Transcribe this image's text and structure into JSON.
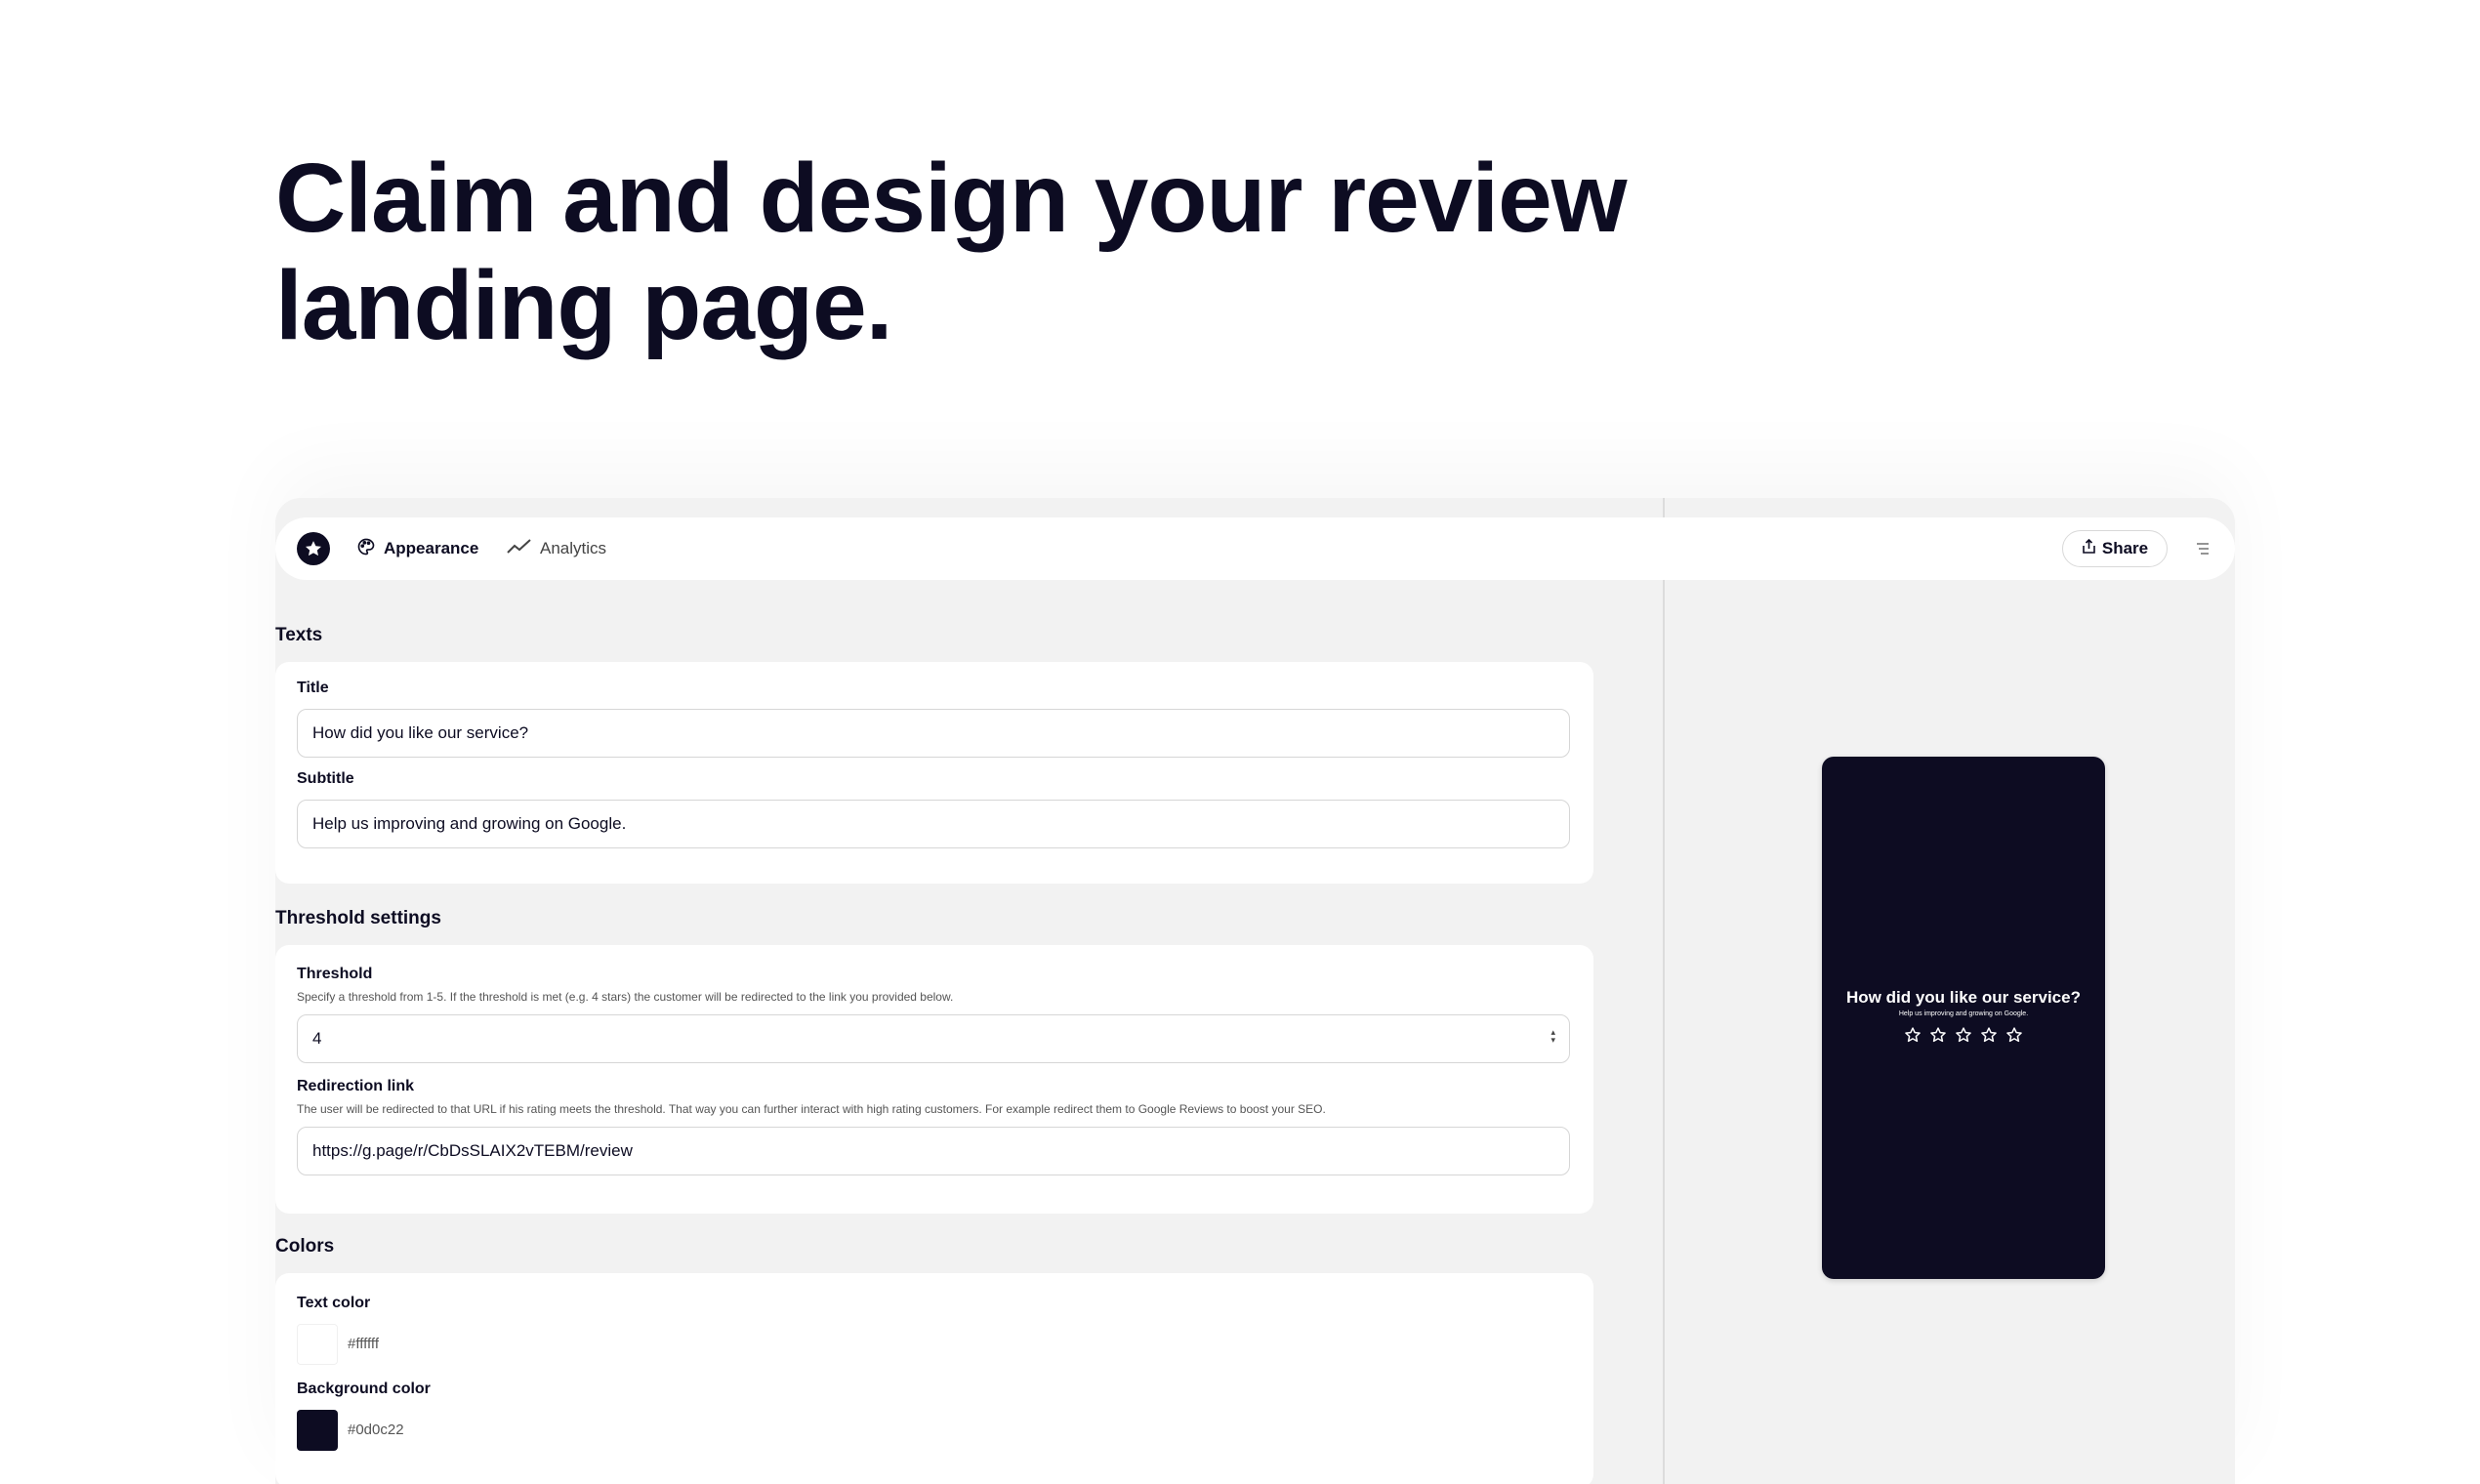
{
  "headline": {
    "line1": "Claim and design your review",
    "line2": "landing page."
  },
  "nav": {
    "appearance_label": "Appearance",
    "analytics_label": "Analytics",
    "share_label": "Share"
  },
  "texts": {
    "section_title": "Texts",
    "title_label": "Title",
    "title_value": "How did you like our service?",
    "subtitle_label": "Subtitle",
    "subtitle_value": "Help us improving and growing on Google."
  },
  "threshold": {
    "section_title": "Threshold settings",
    "threshold_label": "Threshold",
    "threshold_help": "Specify a threshold from 1-5. If the threshold is met (e.g. 4 stars) the customer will be redirected to the link you provided below.",
    "threshold_value": "4",
    "redirect_label": "Redirection link",
    "redirect_help": "The user will be redirected to that URL if his rating meets the threshold. That way you can further interact with high rating customers. For example redirect them to Google Reviews to boost your SEO.",
    "redirect_value": "https://g.page/r/CbDsSLAIX2vTEBM/review"
  },
  "colors": {
    "section_title": "Colors",
    "text_color_label": "Text color",
    "text_color_value": "#ffffff",
    "bg_color_label": "Background color",
    "bg_color_value": "#0d0c22"
  },
  "preview": {
    "title": "How did you like our service?",
    "subtitle": "Help us improving and growing on Google.",
    "star_count": 5
  },
  "icons": [
    "star-logo-icon",
    "palette-icon",
    "trending-up-icon",
    "share-icon",
    "menu-icon",
    "star-outline-icon"
  ]
}
